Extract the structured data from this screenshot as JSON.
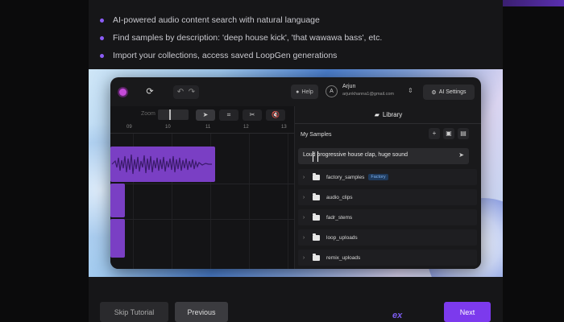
{
  "bullets": [
    "AI-powered audio content search with natural language",
    "Find samples by description: 'deep house kick', 'that wawawa bass', etc.",
    "Import your collections, access saved LoopGen generations"
  ],
  "app": {
    "help_label": "Help",
    "user": {
      "name": "Arjun",
      "email": "arjunkhanna1@gmail.com",
      "initial": "A"
    },
    "ai_settings_label": "AI Settings",
    "zoom_label": "Zoom",
    "ruler_ticks": [
      "09",
      "10",
      "11",
      "12",
      "13"
    ],
    "library": {
      "tab_label": "Library",
      "my_samples_label": "My Samples",
      "search_value": "Loud progressive house clap, huge sound",
      "folders": [
        {
          "name": "factory_samples",
          "badge": "Factory"
        },
        {
          "name": "audio_clips"
        },
        {
          "name": "fadr_stems"
        },
        {
          "name": "loop_uploads"
        },
        {
          "name": "remix_uploads"
        }
      ]
    }
  },
  "footer": {
    "skip_label": "Skip Tutorial",
    "previous_label": "Previous",
    "next_label": "Next",
    "logo_text": "ex"
  },
  "colors": {
    "accent": "#7c3aed",
    "clip": "#7a3fc4",
    "badge_text": "#7fb3f0"
  },
  "icons": {
    "record": "record-icon",
    "loop": "loop-icon",
    "undo": "undo-icon",
    "redo": "redo-icon",
    "pointer": "pointer-icon",
    "select": "marquee-icon",
    "cut": "scissors-icon",
    "mute": "mute-icon",
    "folder": "folder-icon",
    "send": "send-icon"
  }
}
